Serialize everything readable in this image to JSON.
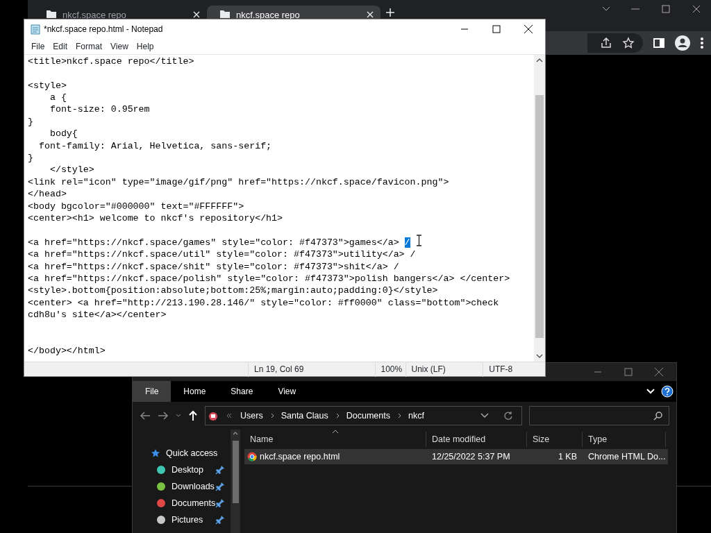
{
  "browser": {
    "tabs": [
      {
        "label": "nkcf.space repo",
        "selected": false
      },
      {
        "label": "nkcf.space repo",
        "selected": true
      }
    ]
  },
  "notepad": {
    "title": "*nkcf.space repo.html - Notepad",
    "menu": [
      "File",
      "Edit",
      "Format",
      "View",
      "Help"
    ],
    "lines": [
      {
        "kind": "code",
        "text": "<title>nkcf.space repo</title>"
      },
      {
        "kind": "blank"
      },
      {
        "kind": "code",
        "text": "<style>"
      },
      {
        "kind": "code",
        "text": "    a {"
      },
      {
        "kind": "code",
        "text": "    font-size: 0.95rem"
      },
      {
        "kind": "code",
        "text": "}"
      },
      {
        "kind": "code",
        "text": "    body{"
      },
      {
        "kind": "code",
        "text": "  font-family: Arial, Helvetica, sans-serif;"
      },
      {
        "kind": "code",
        "text": "}"
      },
      {
        "kind": "code",
        "text": "    </style>"
      },
      {
        "kind": "code",
        "text": "<link rel=\"icon\" type=\"image/gif/png\" href=\"https://nkcf.space/favicon.png\">"
      },
      {
        "kind": "code",
        "text": "</head>"
      },
      {
        "kind": "code",
        "text": "<body bgcolor=\"#000000\" text=\"#FFFFFF\">"
      },
      {
        "kind": "code",
        "text": "<center><h1> welcome to nkcf's repository</h1>"
      },
      {
        "kind": "blank"
      },
      {
        "kind": "code",
        "text": "<a href=\"https://nkcf.space/games\" style=\"color: #f47373\">games</a> ",
        "selected_text": "/"
      },
      {
        "kind": "code",
        "text": "<a href=\"https://nkcf.space/util\" style=\"color: #f47373\">utility</a> /"
      },
      {
        "kind": "code",
        "text": "<a href=\"https://nkcf.space/shit\" style=\"color: #f47373\">shit</a> /"
      },
      {
        "kind": "code",
        "text": "<a href=\"https://nkcf.space/polish\" style=\"color: #f47373\">polish bangers</a> </center>"
      },
      {
        "kind": "code",
        "text": "<style>.bottom{position:absolute;bottom:25%;margin:auto;padding:0}</style>"
      },
      {
        "kind": "code",
        "text": "<center> <a href=\"http://213.190.28.146/\" style=\"color: #ff0000\" class=\"bottom\">check"
      },
      {
        "kind": "code",
        "text": "cdh8u's site</a></center>"
      },
      {
        "kind": "blank"
      },
      {
        "kind": "blank"
      },
      {
        "kind": "code",
        "text": "</body></html>"
      }
    ],
    "status": {
      "position": "Ln 19, Col 69",
      "zoom": "100%",
      "line_ending": "Unix (LF)",
      "encoding": "UTF-8"
    }
  },
  "explorer": {
    "ribbon_tabs": [
      {
        "label": "File",
        "selected": true
      },
      {
        "label": "Home",
        "selected": false
      },
      {
        "label": "Share",
        "selected": false
      },
      {
        "label": "View",
        "selected": false
      }
    ],
    "breadcrumb": [
      "Users",
      "Santa Claus",
      "Documents",
      "nkcf"
    ],
    "nav_items": [
      {
        "label": "Quick access",
        "kind": "header",
        "color": "#3a8ee6"
      },
      {
        "label": "Desktop",
        "kind": "pinned",
        "color": "#3ec6b0"
      },
      {
        "label": "Downloads",
        "kind": "pinned",
        "color": "#7cc242"
      },
      {
        "label": "Documents",
        "kind": "pinned",
        "color": "#e04848"
      },
      {
        "label": "Pictures",
        "kind": "pinned",
        "color": "#c8c8c8"
      }
    ],
    "columns": [
      "Name",
      "Date modified",
      "Size",
      "Type"
    ],
    "files": [
      {
        "name": "nkcf.space repo.html",
        "date": "12/25/2022 5:37 PM",
        "size": "1 KB",
        "type": "Chrome HTML Do...",
        "selected": true
      }
    ]
  }
}
